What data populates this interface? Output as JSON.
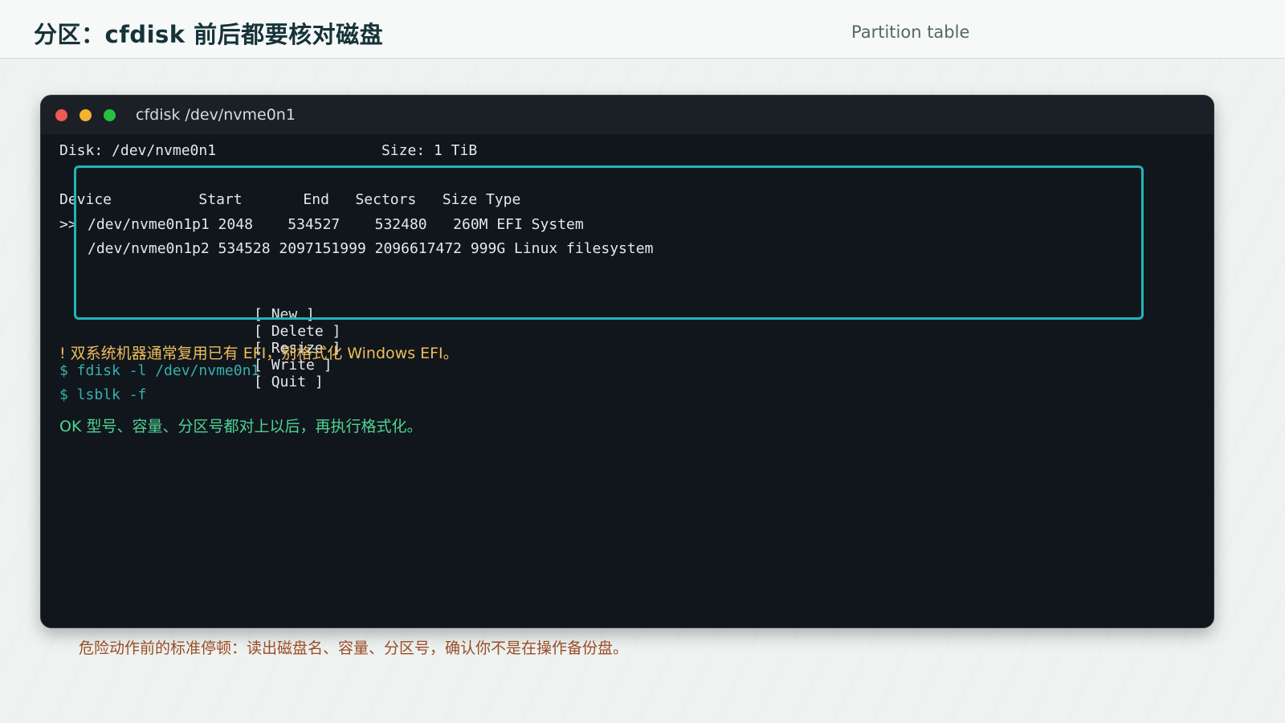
{
  "header": {
    "title": "分区：cfdisk 前后都要核对磁盘",
    "subtitle": "Partition table"
  },
  "terminal": {
    "window_title": "cfdisk /dev/nvme0n1",
    "disk_line": "Disk: /dev/nvme0n1                   Size: 1 TiB",
    "table_header": "Device          Start       End   Sectors   Size Type",
    "rows": [
      "/dev/nvme0n1p1 2048    534527    532480   260M EFI System",
      "/dev/nvme0n1p2 534528 2097151999 2096617472 999G Linux filesystem"
    ],
    "selection_marker": ">>",
    "menu": {
      "new": "[ New ]",
      "delete": "[ Delete ]",
      "resize": "[ Resize ]",
      "write": "[ Write ]",
      "quit": "[ Quit ]"
    },
    "warning": "! 双系统机器通常复用已有 EFI，别格式化 Windows EFI。",
    "commands": [
      "$ fdisk -l /dev/nvme0n1",
      "$ lsblk -f"
    ],
    "ok_note": "OK 型号、容量、分区号都对上以后，再执行格式化。"
  },
  "footer": {
    "note": "危险动作前的标准停顿：读出磁盘名、容量、分区号，确认你不是在操作备份盘。"
  },
  "colors": {
    "accent_box": "#22b5b6",
    "warning": "#efbd5a",
    "command": "#36b0ad",
    "ok": "#4fd394",
    "footer_note": "#9a4b24"
  }
}
